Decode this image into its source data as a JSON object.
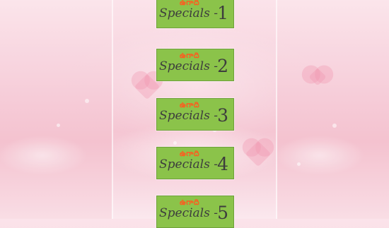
{
  "menu": {
    "items": [
      {
        "script": "ఉగాది",
        "title": "Specials -",
        "number": "1"
      },
      {
        "script": "ఉగాది",
        "title": "Specials -",
        "number": "2"
      },
      {
        "script": "ఉగాది",
        "title": "Specials -",
        "number": "3"
      },
      {
        "script": "ఉగాది",
        "title": "Specials -",
        "number": "4"
      },
      {
        "script": "ఉగాది",
        "title": "Specials -",
        "number": "5"
      }
    ]
  },
  "colors": {
    "button_bg": "#8bc34a",
    "script_text": "#ff5a1f",
    "title_text": "#3d3d3d",
    "background": "#f7d2dd"
  }
}
